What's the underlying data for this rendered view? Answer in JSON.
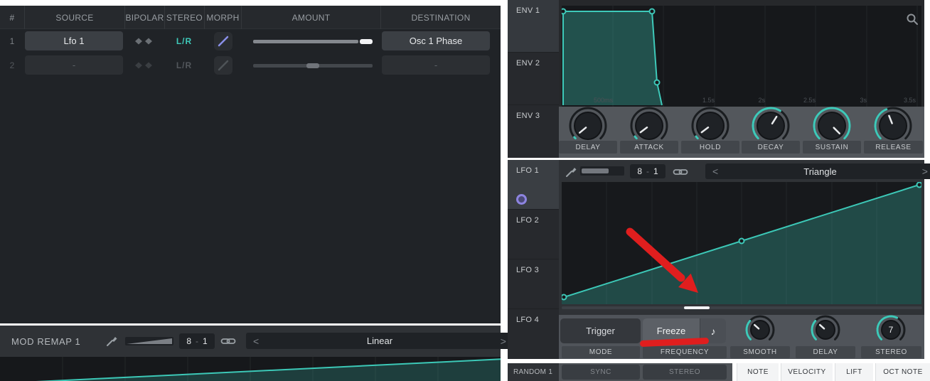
{
  "colors": {
    "teal": "#3ec9b9",
    "purple": "#8a8fe8",
    "red": "#e01e1e"
  },
  "matrix": {
    "headers": {
      "num": "#",
      "source": "SOURCE",
      "bipolar": "BIPOLAR",
      "stereo": "STEREO",
      "morph": "MORPH",
      "amount": "AMOUNT",
      "destination": "DESTINATION"
    },
    "rows": [
      {
        "num": "1",
        "source": "Lfo 1",
        "stereo": "L/R",
        "destination": "Osc 1 Phase",
        "amount_pct": 88
      },
      {
        "num": "2",
        "source": "-",
        "stereo": "L/R",
        "destination": "-",
        "amount_pct": 50
      }
    ]
  },
  "mod_remap": {
    "title": "MOD REMAP 1",
    "value_a": "8",
    "dash": "-",
    "value_b": "1",
    "prev": "<",
    "shape": "Linear",
    "next": ">"
  },
  "envelope": {
    "tabs": [
      "ENV 1",
      "ENV 2",
      "ENV 3"
    ],
    "time_labels": [
      "500ms",
      "1.5s",
      "2s",
      "2.5s",
      "3s",
      "3.5s"
    ],
    "knobs": [
      {
        "label": "DELAY",
        "value": 0.02
      },
      {
        "label": "ATTACK",
        "value": 0.03
      },
      {
        "label": "HOLD",
        "value": 0.03
      },
      {
        "label": "DECAY",
        "value": 0.62
      },
      {
        "label": "SUSTAIN",
        "value": 1
      },
      {
        "label": "RELEASE",
        "value": 0.42
      }
    ]
  },
  "lfo": {
    "tabs": [
      "LFO 1",
      "LFO 2",
      "LFO 3",
      "LFO 4"
    ],
    "value_a": "8",
    "dash": "-",
    "value_b": "1",
    "prev": "<",
    "shape": "Triangle",
    "next": ">",
    "mode_button": "Trigger",
    "freeze_button": "Freeze",
    "note_icon": "♪",
    "mode_label": "MODE",
    "frequency_label": "FREQUENCY",
    "knobs": [
      {
        "label": "SMOOTH",
        "value": 0.32
      },
      {
        "label": "DELAY",
        "value": 0.32
      },
      {
        "label": "STEREO",
        "value": 0.6,
        "display": "7"
      }
    ],
    "sync_button": "SYNC",
    "stereo_button": "STEREO"
  },
  "random": {
    "label": "RANDOM 1"
  },
  "keytrack": {
    "buttons": [
      "NOTE",
      "VELOCITY",
      "LIFT",
      "OCT NOTE"
    ]
  }
}
